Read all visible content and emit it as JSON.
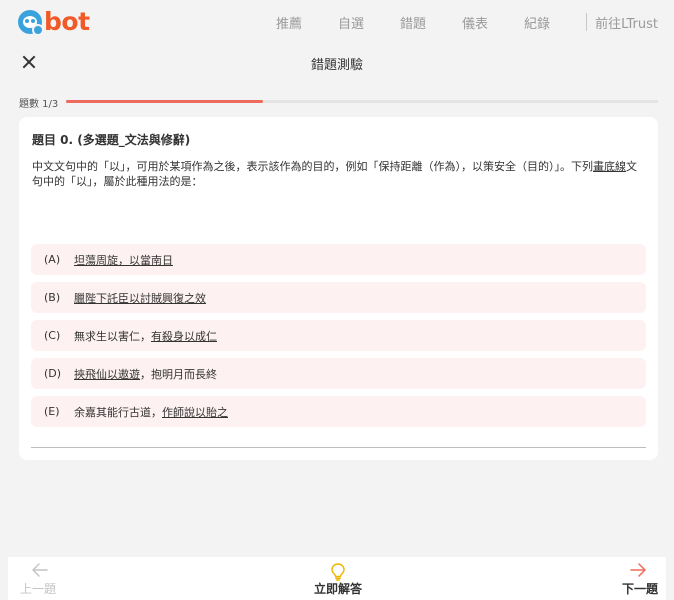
{
  "brand": {
    "logo_text": "bot",
    "colors": {
      "logo_q": "#3aa3de",
      "logo_text": "#f05a28",
      "accent": "#ec6b5d"
    }
  },
  "nav": {
    "items": [
      "推薦",
      "自選",
      "錯題",
      "儀表",
      "紀錄"
    ],
    "ltrust": "前往LTrust"
  },
  "header": {
    "title": "錯題測驗",
    "close_icon": "close-icon"
  },
  "progress": {
    "label": "題數 1/3",
    "current": 1,
    "total": 3
  },
  "question": {
    "title": "題目 0. (多選題_文法與修辭)",
    "stem_before": "中文文句中的「以」，可用於某項作為之後，表示該作為的目的，例如「保持距離（作為），以策安全（目的）」。下列",
    "stem_underline": "畫底線",
    "stem_after": "文句中的「以」，屬於此種用法的是："
  },
  "options": [
    {
      "letter": "(A)",
      "pre": "",
      "underlined": "坦蕩周旋，以當南日",
      "post": ""
    },
    {
      "letter": "(B)",
      "pre": "",
      "underlined": "臘陛下託臣以討賊興復之效",
      "post": ""
    },
    {
      "letter": "(C)",
      "pre": "無求生以害仁，",
      "underlined": "有殺身以成仁",
      "post": ""
    },
    {
      "letter": "(D)",
      "pre": "",
      "underlined": "挾飛仙以遨遊",
      "post": "，抱明月而長終"
    },
    {
      "letter": "(E)",
      "pre": "余嘉其能行古道，",
      "underlined": "作師說以貽之",
      "post": ""
    }
  ],
  "bottom": {
    "prev": "上一題",
    "answer": "立即解答",
    "next": "下一題",
    "icons": {
      "prev": "arrow-left-icon",
      "answer": "lightbulb-icon",
      "next": "arrow-right-icon"
    },
    "colors": {
      "prev_disabled": "#c4c4c4",
      "bulb": "#f0b400",
      "next_arrow": "#ec6b5d"
    }
  }
}
